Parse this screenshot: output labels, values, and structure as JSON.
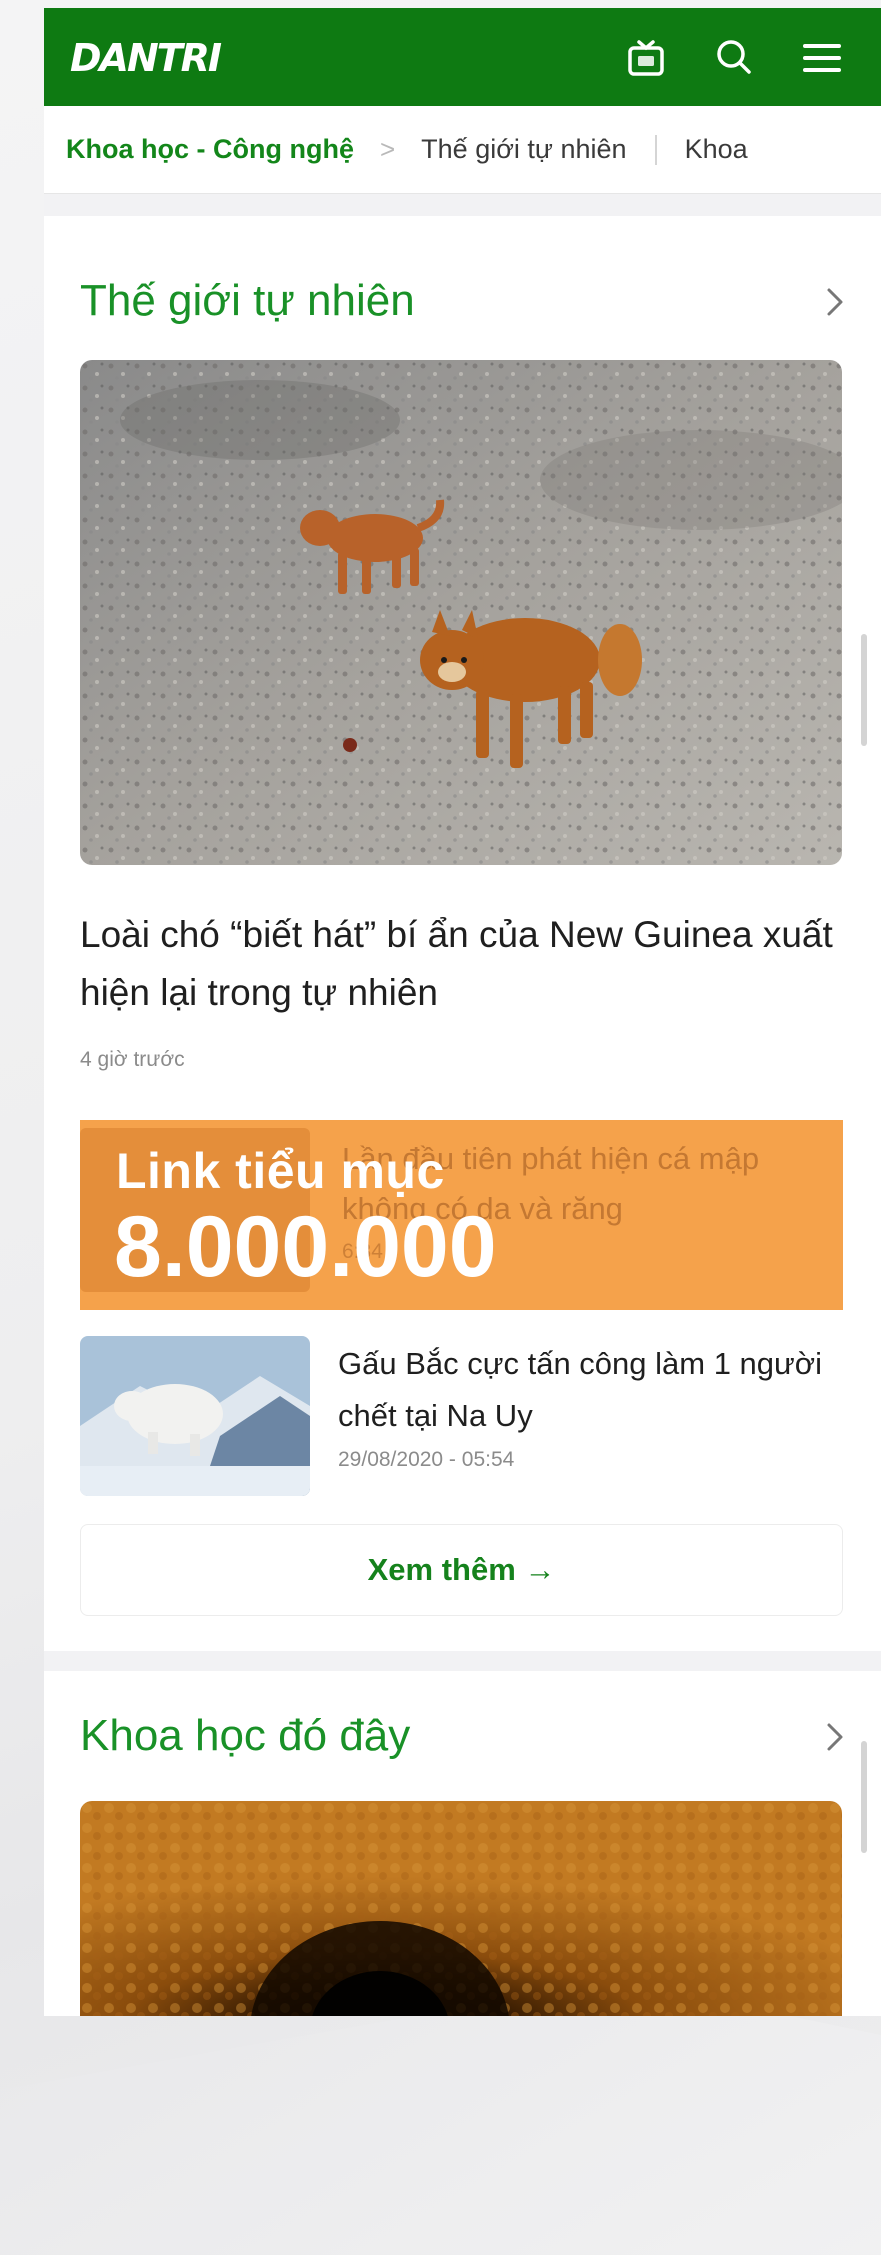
{
  "header": {
    "logo": "DANTRI",
    "icons": [
      "tv-icon",
      "search-icon",
      "menu-icon"
    ]
  },
  "breadcrumb": {
    "active": "Khoa học - Công nghệ",
    "separator": ">",
    "item": "Thế giới tự nhiên",
    "next": "Khoa"
  },
  "section1": {
    "title": "Thế giới tự nhiên",
    "headline": "Loài chó “biết hát” bí ẩn của New Guinea xuất hiện lại trong tự nhiên",
    "time": "4 giờ trước",
    "promo": {
      "label": "Link tiểu mục",
      "number": "8.000.000",
      "hidden_title": "Lần đầu tiên phát hiện cá mập không có da và răng",
      "hidden_time": "6:34"
    },
    "item2": {
      "title": "Gấu Bắc cực tấn công làm 1 người chết tại Na Uy",
      "time": "29/08/2020 - 05:54"
    },
    "more": "Xem thêm →"
  },
  "section2": {
    "title": "Khoa học đó đây"
  },
  "colors": {
    "brand_green": "#0e7a12",
    "title_green": "#199127",
    "promo_orange": "#f5a24b"
  }
}
